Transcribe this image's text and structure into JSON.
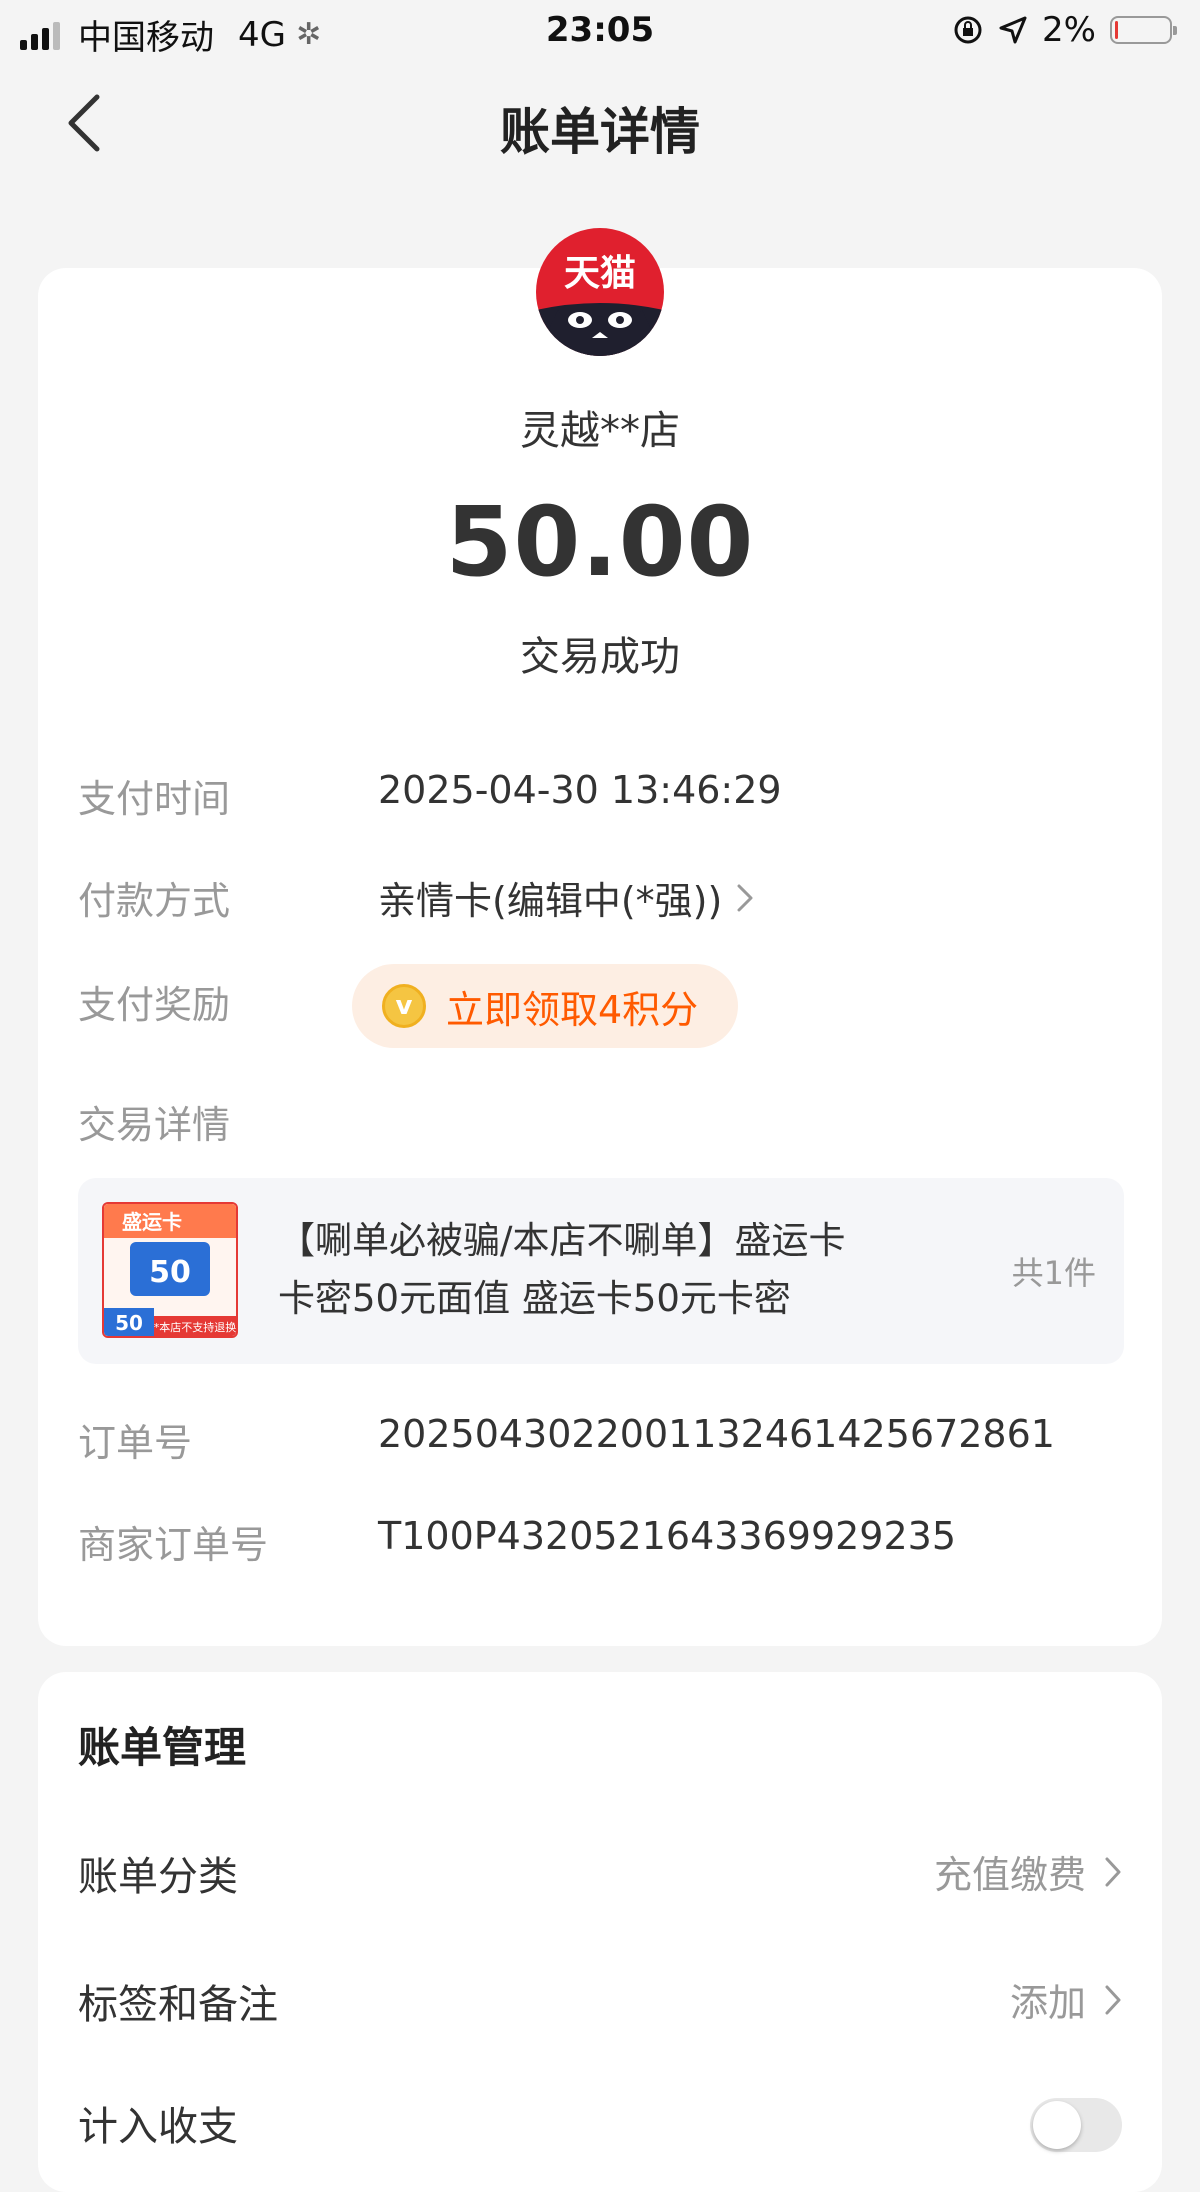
{
  "status_bar": {
    "carrier": "中国移动",
    "network": "4G",
    "time": "23:05",
    "battery": "2%",
    "battery_level": 0.02
  },
  "nav": {
    "title": "账单详情"
  },
  "merchant": {
    "logo_text": "天猫",
    "name": "灵越**店",
    "amount": "50.00",
    "status": "交易成功"
  },
  "details": {
    "pay_time_label": "支付时间",
    "pay_time": "2025-04-30 13:46:29",
    "pay_method_label": "付款方式",
    "pay_method": "亲情卡(编辑中(*强))",
    "reward_label": "支付奖励",
    "reward_text": "立即领取4积分",
    "trade_detail_label": "交易详情",
    "order_no_label": "订单号",
    "order_no": "2025043022001132461425672861",
    "merchant_order_label": "商家订单号",
    "merchant_order_no": "T100P4320521643369929235"
  },
  "goods": {
    "title": "【唰单必被骗/本店不唰单】盛运卡卡密50元面值 盛运卡50元卡密",
    "count": "共1件",
    "thumb_brand": "盛运卡",
    "thumb_value": "50",
    "thumb_price": "50",
    "thumb_notice": "*本店不支持退换"
  },
  "manage": {
    "title": "账单管理",
    "category_label": "账单分类",
    "category_value": "充值缴费",
    "tags_label": "标签和备注",
    "tags_value": "添加",
    "income_label": "计入收支"
  },
  "colors": {
    "accent_orange": "#ff5a00",
    "tmall_red": "#e0202e",
    "background": "#f4f4f4"
  }
}
